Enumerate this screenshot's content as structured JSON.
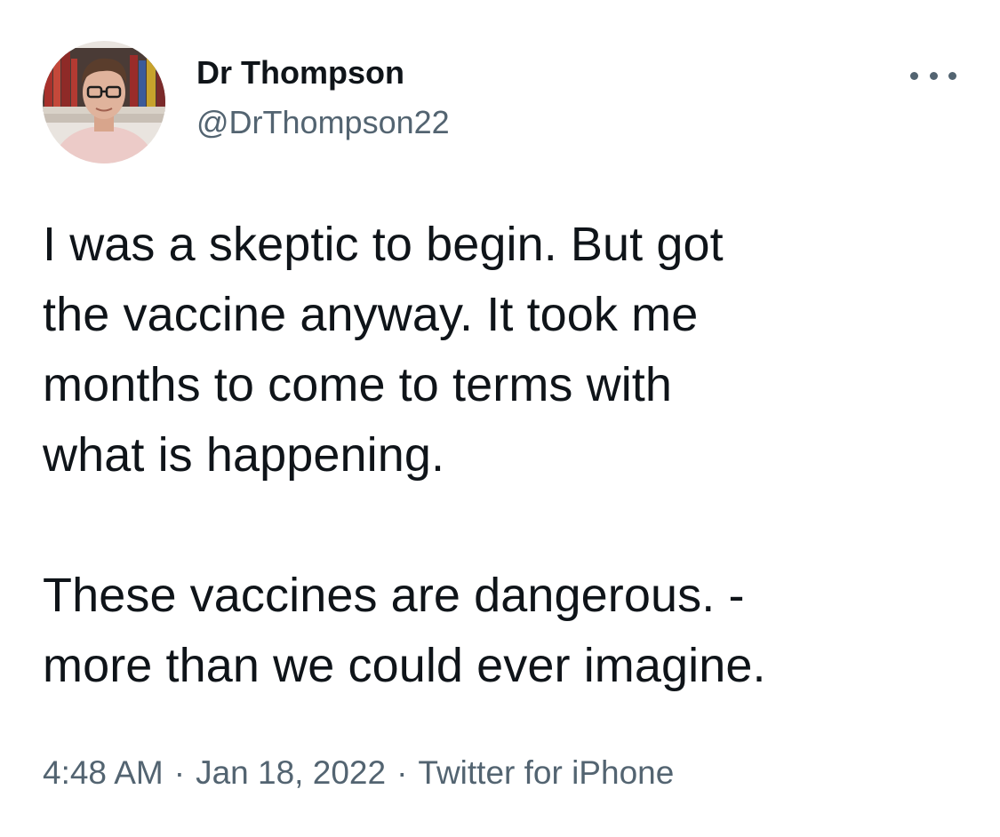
{
  "author": {
    "display_name": "Dr Thompson",
    "handle": "@DrThompson22",
    "avatar_icon": "profile-photo"
  },
  "more_icon": "more-horizontal-icon",
  "tweet": {
    "paragraphs": [
      [
        "I was a skeptic to begin. But got",
        "the vaccine anyway. It took me",
        "months to come to terms with",
        "what is happening."
      ],
      [
        "These vaccines are dangerous. -",
        "more than we could ever imagine."
      ]
    ]
  },
  "meta": {
    "time": "4:48 AM",
    "separator": "·",
    "date": "Jan 18, 2022",
    "source": "Twitter for iPhone"
  },
  "colors": {
    "text_primary": "#0f1419",
    "text_secondary": "#536471",
    "background": "#ffffff"
  }
}
